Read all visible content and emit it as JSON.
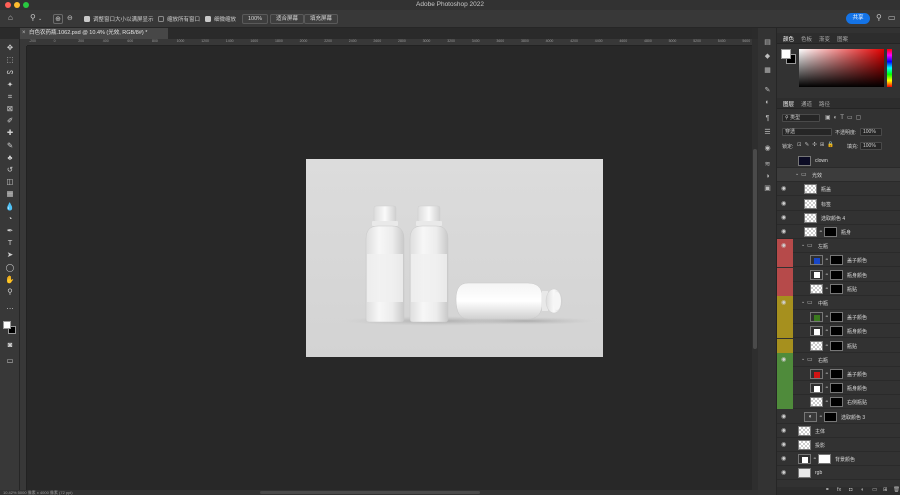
{
  "app": {
    "title": "Adobe Photoshop 2022"
  },
  "options_bar": {
    "resize_windows_label": "调整窗口大小以满屏显示",
    "zoom_all_windows_label": "缩放所有窗口",
    "scrubby_zoom_label": "细微缩放",
    "zoom_value": "100%",
    "fit_screen_label": "适合屏幕",
    "fill_screen_label": "填充屏幕",
    "share_label": "共享"
  },
  "document": {
    "tab_title": "白色农药瓶.1062.psd @ 10.4% (光效, RGB/8#) *",
    "status": "10.42%    5000 像素 x 4000 像素 (72 ppi)"
  },
  "ruler_ticks": [
    "-200",
    "0",
    "200",
    "400",
    "600",
    "800",
    "1000",
    "1200",
    "1400",
    "1600",
    "1800",
    "2000",
    "2200",
    "2400",
    "2600",
    "2800",
    "3000",
    "3200",
    "3400",
    "3600",
    "3800",
    "4000",
    "4200",
    "4400",
    "4600",
    "4800",
    "5000",
    "5200",
    "5400",
    "5600"
  ],
  "color_panel": {
    "tabs": [
      "颜色",
      "色板",
      "渐变",
      "图案"
    ],
    "active_tab": "颜色",
    "fg": "#ffffff",
    "bg": "#000000"
  },
  "layers_panel": {
    "tabs": [
      "图层",
      "通道",
      "路径"
    ],
    "active_tab": "图层",
    "filter_label": "类型",
    "blend_mode": "穿透",
    "opacity_label": "不透明度:",
    "opacity_value": "100%",
    "lock_label": "锁定:",
    "fill_label": "填充:",
    "fill_value": "100%",
    "layers": [
      {
        "name": "clown",
        "kind": "dark",
        "indent": 0,
        "band": null,
        "eye": false
      },
      {
        "name": "光效",
        "kind": "group",
        "indent": 0,
        "band": null,
        "eye": false,
        "selected": true
      },
      {
        "name": "瓶盖",
        "kind": "checker",
        "indent": 1,
        "band": null,
        "eye": true
      },
      {
        "name": "标签",
        "kind": "checker",
        "indent": 1,
        "band": null,
        "eye": true
      },
      {
        "name": "选取颜色 4",
        "kind": "checker",
        "indent": 1,
        "band": null,
        "eye": true
      },
      {
        "name": "瓶身",
        "kind": "smart-mask",
        "indent": 1,
        "band": null,
        "eye": true
      },
      {
        "name": "左瓶",
        "kind": "group",
        "indent": 1,
        "band": "red",
        "eye": true
      },
      {
        "name": "盖子颜色",
        "kind": "fill-mask",
        "swatch": "#1847c8",
        "indent": 2,
        "band": "red",
        "eye": false
      },
      {
        "name": "瓶身颜色",
        "kind": "fill-mask",
        "swatch": "#ffffff",
        "indent": 2,
        "band": "red",
        "eye": false
      },
      {
        "name": "瓶贴",
        "kind": "smart-mask",
        "indent": 2,
        "band": "red",
        "eye": false
      },
      {
        "name": "中瓶",
        "kind": "group",
        "indent": 1,
        "band": "yellow",
        "eye": true
      },
      {
        "name": "盖子颜色",
        "kind": "fill-mask",
        "swatch": "#3b7a1e",
        "indent": 2,
        "band": "yellow",
        "eye": false
      },
      {
        "name": "瓶身颜色",
        "kind": "fill-mask",
        "swatch": "#ffffff",
        "indent": 2,
        "band": "yellow",
        "eye": false
      },
      {
        "name": "瓶贴",
        "kind": "smart-mask",
        "indent": 2,
        "band": "yellow",
        "eye": false
      },
      {
        "name": "右瓶",
        "kind": "group",
        "indent": 1,
        "band": "green",
        "eye": true
      },
      {
        "name": "盖子颜色",
        "kind": "fill-mask",
        "swatch": "#d01414",
        "indent": 2,
        "band": "green",
        "eye": false
      },
      {
        "name": "瓶身颜色",
        "kind": "fill-mask",
        "swatch": "#ffffff",
        "indent": 2,
        "band": "green",
        "eye": false
      },
      {
        "name": "右侧瓶贴",
        "kind": "smart-mask",
        "indent": 2,
        "band": "green",
        "eye": false
      },
      {
        "name": "选取颜色 3",
        "kind": "adjust-mask",
        "indent": 1,
        "band": null,
        "eye": true
      },
      {
        "name": "主体",
        "kind": "checker",
        "indent": 0,
        "band": null,
        "eye": true
      },
      {
        "name": "投影",
        "kind": "checker",
        "indent": 0,
        "band": null,
        "eye": true
      },
      {
        "name": "背景颜色",
        "kind": "fill-mask",
        "swatch": "#ffffff",
        "indent": 0,
        "band": null,
        "eye": true
      },
      {
        "name": "rgb",
        "kind": "white",
        "indent": 0,
        "band": null,
        "eye": true
      }
    ]
  },
  "colors": {
    "band_red": "#b64a4a",
    "band_yellow": "#a6901e",
    "band_green": "#4f8b3b",
    "selected_row": "#3c3c3c",
    "accent": "#1473e6"
  },
  "icons": {
    "tools": [
      "move-icon",
      "marquee-icon",
      "lasso-icon",
      "magic-wand-icon",
      "crop-icon",
      "frame-icon",
      "eyedropper-icon",
      "healing-icon",
      "brush-icon",
      "stamp-icon",
      "history-brush-icon",
      "eraser-icon",
      "gradient-icon",
      "blur-icon",
      "dodge-icon",
      "pen-icon",
      "type-icon",
      "path-select-icon",
      "shape-icon",
      "hand-icon",
      "zoom-icon"
    ]
  }
}
